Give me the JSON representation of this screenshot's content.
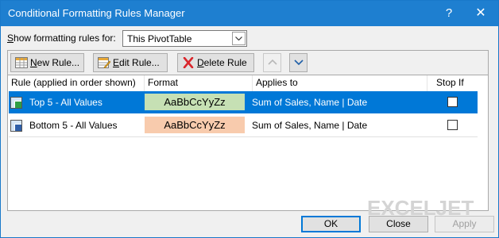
{
  "window": {
    "title": "Conditional Formatting Rules Manager",
    "help_glyph": "?",
    "close_glyph": "✕"
  },
  "show_rules": {
    "label_prefix": "",
    "label_accel": "S",
    "label_rest": "how formatting rules for:",
    "selected": "This PivotTable"
  },
  "toolbar": {
    "new_accel": "N",
    "new_rest": "ew Rule...",
    "edit_accel": "E",
    "edit_rest": "dit Rule...",
    "delete_accel": "D",
    "delete_rest": "elete Rule"
  },
  "columns": {
    "rule": "Rule (applied in order shown)",
    "format": "Format",
    "applies": "Applies to",
    "stop": "Stop If True"
  },
  "rules": [
    {
      "name": "Top 5 - All Values",
      "preview": "AaBbCcYyZz",
      "applies": "Sum of Sales, Name | Date",
      "stop_if_true": false,
      "selected": true,
      "swatch_color": "#c6e0b4"
    },
    {
      "name": "Bottom 5 - All Values",
      "preview": "AaBbCcYyZz",
      "applies": "Sum of Sales, Name | Date",
      "stop_if_true": false,
      "selected": false,
      "swatch_color": "#f8cbad"
    }
  ],
  "watermark": "EXCELJET",
  "buttons": {
    "ok": "OK",
    "close": "Close",
    "apply": "Apply"
  },
  "colors": {
    "title_bar": "#1e7fd0",
    "selection": "#0078d7"
  }
}
